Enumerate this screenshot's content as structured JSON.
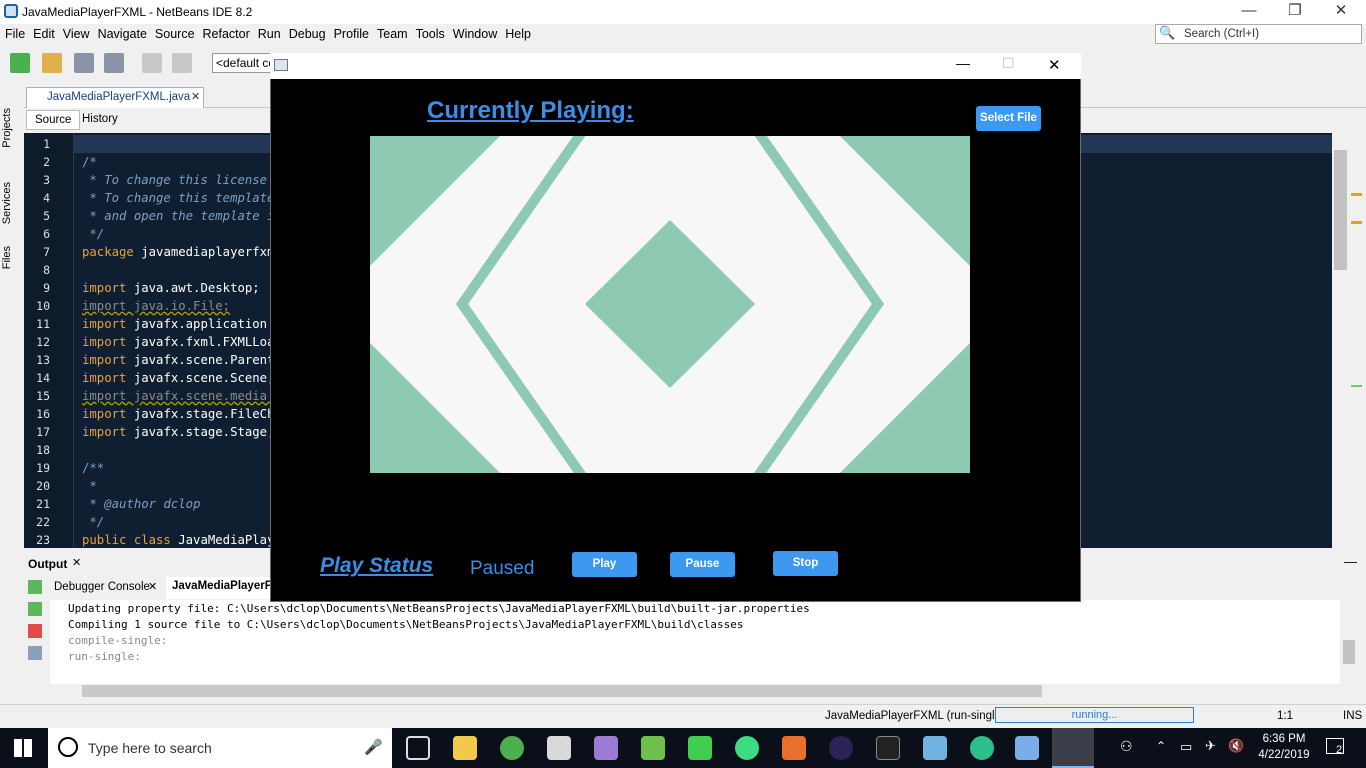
{
  "ide": {
    "title": "JavaMediaPlayerFXML - NetBeans IDE 8.2",
    "window_controls": {
      "minimize": "—",
      "restore": "❐",
      "close": "✕"
    },
    "menu": [
      "File",
      "Edit",
      "View",
      "Navigate",
      "Source",
      "Refactor",
      "Run",
      "Debug",
      "Profile",
      "Team",
      "Tools",
      "Window",
      "Help"
    ],
    "search_placeholder": "Search (Ctrl+I)",
    "config_combo": "<default config>",
    "side_tabs": [
      "Projects",
      "Services",
      "Files"
    ],
    "editor_tab": "JavaMediaPlayerFXML.java",
    "source_tabs": {
      "source": "Source",
      "history": "History"
    },
    "line_numbers": [
      "1",
      "2",
      "3",
      "4",
      "5",
      "6",
      "7",
      "8",
      "9",
      "10",
      "11",
      "12",
      "13",
      "14",
      "15",
      "16",
      "17",
      "18",
      "19",
      "20",
      "21",
      "22",
      "23"
    ],
    "code": {
      "l1": "/*",
      "l2": " * To change this license header, choose License Headers in Project Properties.",
      "l3": " * To change this template file, choose Tools | Templates",
      "l4": " * and open the template in the editor.",
      "l5": " */",
      "l6_kw": "package",
      "l6_rest": " javamediaplayerfxml;",
      "import_kw": "import",
      "l8": " java.awt.Desktop;",
      "l9": "import java.io.File;",
      "l10": " javafx.application.Application;",
      "l11": " javafx.fxml.FXMLLoader;",
      "l12": " javafx.scene.Parent;",
      "l13": " javafx.scene.Scene;",
      "l14": "import javafx.scene.media.Media;",
      "l15": " javafx.stage.FileChooser;",
      "l16": " javafx.stage.Stage;",
      "l18": "/**",
      "l19": " *",
      "l20_tag": " * @author",
      "l20_name": " dclop",
      "l21": " */",
      "l22_kw": "public class",
      "l22_rest": " JavaMediaPlayerFXML"
    },
    "output_tab": "Output",
    "output_subtabs": {
      "debugger": "Debugger Console",
      "run": "JavaMediaPlayerFXML (run-single)"
    },
    "output_lines": [
      "Updating property file: C:\\Users\\dclop\\Documents\\NetBeansProjects\\JavaMediaPlayerFXML\\build\\built-jar.properties",
      "Compiling 1 source file to C:\\Users\\dclop\\Documents\\NetBeansProjects\\JavaMediaPlayerFXML\\build\\classes",
      "compile-single:",
      "run-single:"
    ],
    "status": {
      "task": "JavaMediaPlayerFXML (run-single)",
      "progress": "running...",
      "position": "1:1",
      "mode": "INS"
    }
  },
  "player": {
    "heading": "Currently Playing:",
    "select_file": "Select File",
    "play_status_label": "Play Status",
    "status_value": "Paused",
    "buttons": {
      "play": "Play",
      "pause": "Pause",
      "stop": "Stop"
    },
    "window_controls": {
      "minimize": "—",
      "maximize": "☐",
      "close": "✕"
    },
    "video_colors": {
      "teal": "#8ec9b2",
      "white": "#f7f7f9"
    }
  },
  "taskbar": {
    "search_placeholder": "Type here to search",
    "time": "6:36 PM",
    "date": "4/22/2019",
    "notification_count": "2"
  },
  "colors": {
    "accent": "#3b8de6",
    "button": "#3d98f0",
    "editor_bg": "#0f1f31",
    "keyword": "#e6a13b"
  }
}
